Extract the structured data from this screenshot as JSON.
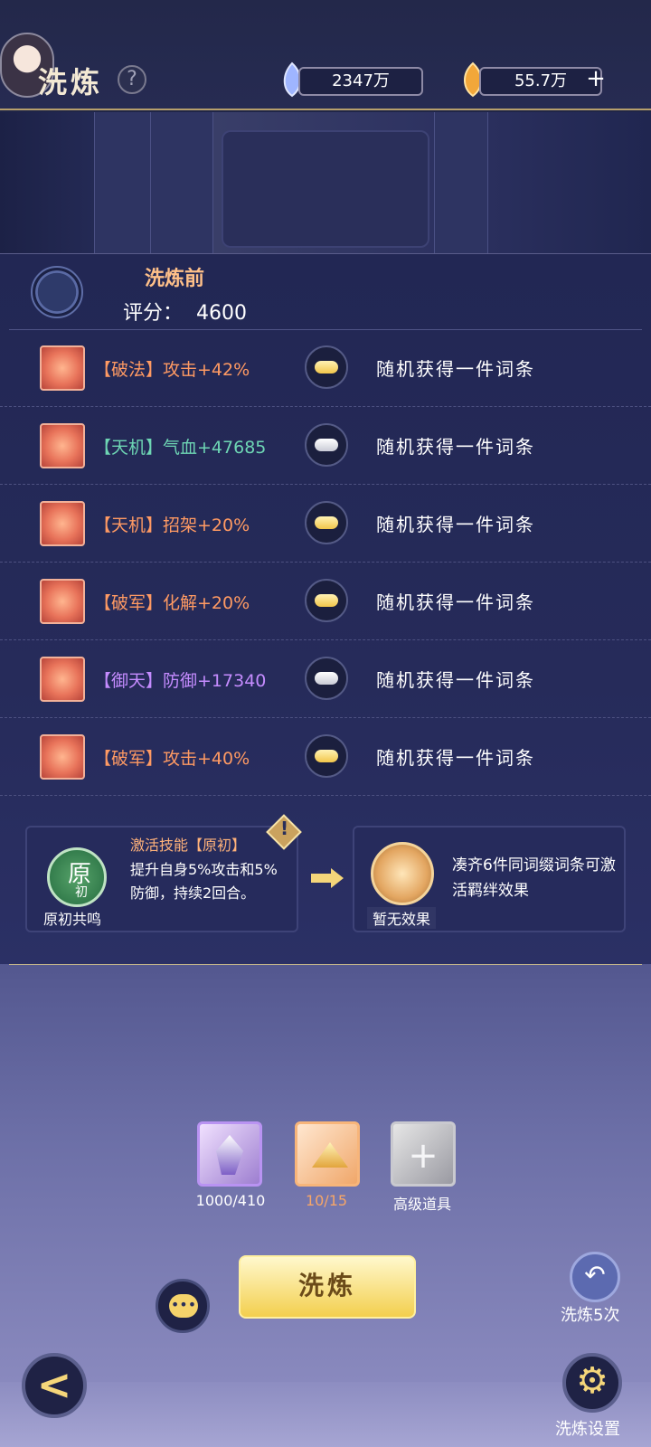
{
  "header": {
    "title": "洗炼",
    "help_icon": "question-icon",
    "currencies": [
      {
        "icon": "spirit-stone-icon",
        "value": "2347万"
      },
      {
        "icon": "flame-coin-icon",
        "value": "55.7万"
      }
    ],
    "add_label": "+"
  },
  "score": {
    "title": "洗炼前",
    "label": "评分：",
    "value": "4600"
  },
  "attributes": [
    {
      "tag": "【破法】",
      "stat": "攻击+42%",
      "color": "#ff9a63",
      "lock": "gold",
      "desc": "随机获得一件词条"
    },
    {
      "tag": "【天机】",
      "stat": "气血+47685",
      "color": "#6ed6b4",
      "lock": "silver",
      "desc": "随机获得一件词条"
    },
    {
      "tag": "【天机】",
      "stat": "招架+20%",
      "color": "#ff9a63",
      "lock": "gold",
      "desc": "随机获得一件词条"
    },
    {
      "tag": "【破军】",
      "stat": "化解+20%",
      "color": "#ff9a63",
      "lock": "gold",
      "desc": "随机获得一件词条"
    },
    {
      "tag": "【御天】",
      "stat": "防御+17340",
      "color": "#c58cff",
      "lock": "silver",
      "desc": "随机获得一件词条"
    },
    {
      "tag": "【破军】",
      "stat": "攻击+40%",
      "color": "#ff9a63",
      "lock": "gold",
      "desc": "随机获得一件词条"
    }
  ],
  "skill": {
    "title": "激活技能【原初】",
    "icon_char": "原",
    "icon_char2": "初",
    "tag": "原初共鸣",
    "desc": "提升自身5%攻击和5%防御，持续2回合。"
  },
  "bond": {
    "tag": "暂无效果",
    "desc": "凑齐6件同词缀词条可激活羁绊效果"
  },
  "items": [
    {
      "count": "1000/410",
      "color": "#ffffff"
    },
    {
      "count": "10/15",
      "color": "#f7a667"
    },
    {
      "count": "高级道具",
      "color": "#ffffff"
    }
  ],
  "actions": {
    "wash_label": "洗炼",
    "undo_label": "洗炼5次",
    "settings_label": "洗炼设置"
  },
  "colors": {
    "accent_gold": "#f3cf4e",
    "orange_text": "#ff9a63",
    "panel_bg": "#262b5c"
  }
}
